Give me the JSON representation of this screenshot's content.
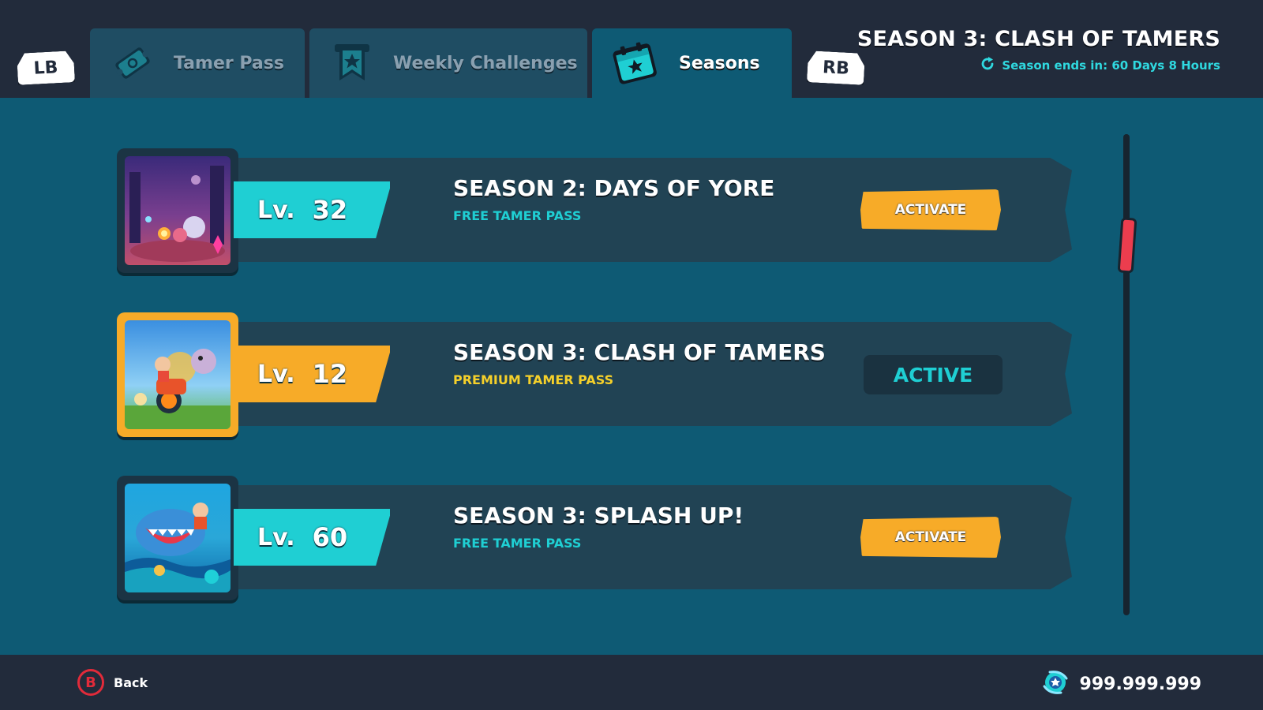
{
  "header": {
    "left_bumper": "LB",
    "right_bumper": "RB",
    "tabs": [
      {
        "label": "Tamer Pass",
        "icon": "ticket-icon"
      },
      {
        "label": "Weekly Challenges",
        "icon": "bookmark-star-icon"
      },
      {
        "label": "Seasons",
        "icon": "calendar-star-icon",
        "selected": true
      }
    ],
    "current_season_title": "SEASON 3: CLASH OF TAMERS",
    "season_timer": "Season ends in: 60 Days 8 Hours",
    "timer_icon": "refresh-icon"
  },
  "seasons": [
    {
      "level_prefix": "Lv.",
      "level": "32",
      "name": "SEASON 2: DAYS OF YORE",
      "pass_type": "FREE TAMER PASS",
      "action": "ACTIVATE",
      "active": false
    },
    {
      "level_prefix": "Lv.",
      "level": "12",
      "name": "SEASON 3: CLASH OF TAMERS",
      "pass_type": "PREMIUM TAMER PASS",
      "action": "ACTIVE",
      "active": true
    },
    {
      "level_prefix": "Lv.",
      "level": "60",
      "name": "SEASON 3: SPLASH UP!",
      "pass_type": "FREE TAMER PASS",
      "action": "ACTIVATE",
      "active": false
    }
  ],
  "footer": {
    "back_button_glyph": "B",
    "back_label": "Back",
    "currency_icon": "gem-orb-icon",
    "currency_value": "999.999.999"
  },
  "colors": {
    "background": "#0e5a74",
    "bar": "#222b3b",
    "cyan_accent": "#1fcfd3",
    "orange_accent": "#f7ab28",
    "premium_yellow": "#f5d02a",
    "scroll_thumb": "#ec3d4e",
    "back_button_red": "#e12b3a"
  }
}
